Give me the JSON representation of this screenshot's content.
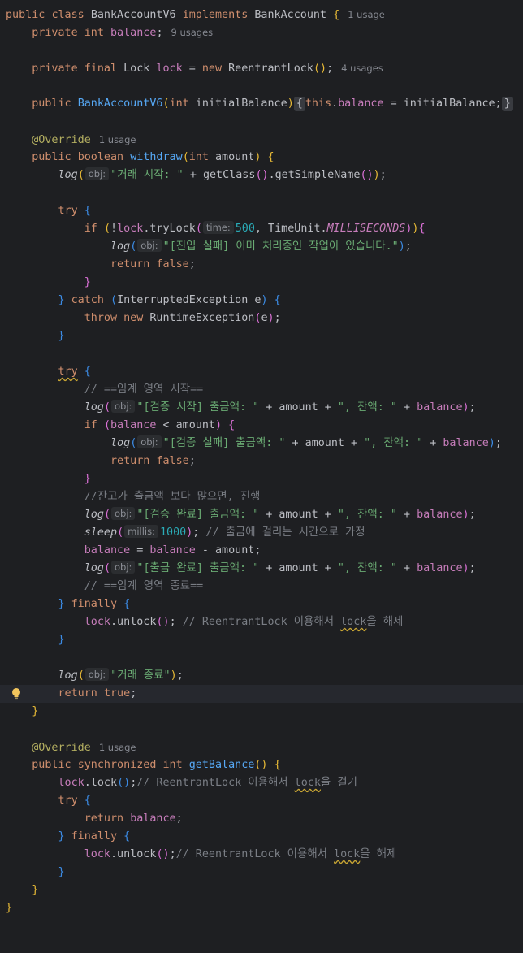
{
  "bank_class": {
    "kw_public": "public",
    "kw_class": "class",
    "name": "BankAccountV6",
    "kw_implements": "implements",
    "iface": "BankAccount",
    "brace": "{",
    "usage": "1 usage"
  },
  "balance_field": {
    "kw_private": "private",
    "kw_int": "int",
    "name": "balance",
    "semi": ";",
    "usage": "9 usages"
  },
  "lock_field": {
    "kw_private": "private",
    "kw_final": "final",
    "type": "Lock",
    "name": "lock",
    "eq": "=",
    "kw_new": "new",
    "ctor": "ReentrantLock",
    "parens": "()",
    "semi": ";",
    "usage": "4 usages"
  },
  "constructor": {
    "kw_public": "public",
    "name": "BankAccountV6",
    "open": "(",
    "kw_int": "int",
    "param": "initialBalance",
    "close": ")",
    "fold_open": "{",
    "kw_this": "this",
    "dot": ".",
    "field": "balance",
    "assign": "=",
    "value": "initialBalance;",
    "fold_close": "}"
  },
  "withdraw": {
    "annotation": "@Override",
    "usage": "1 usage",
    "kw_public": "public",
    "kw_boolean": "boolean",
    "name": "withdraw",
    "open": "(",
    "kw_int": "int",
    "param": "amount",
    "close": ")",
    "brace": "{"
  },
  "log_start": {
    "fn": "log",
    "open": "(",
    "hint": "obj:",
    "str": "\"거래 시작: \"",
    "plus": "+",
    "call1": "getClass",
    "p1": "()",
    "call2": ".getSimpleName",
    "p2": "()",
    "close": ")",
    "semi": ";"
  },
  "try1": {
    "kw_try": "try",
    "brace": "{"
  },
  "if_trylock": {
    "kw_if": "if",
    "open": "(",
    "not": "!",
    "field": "lock",
    "call": ".tryLock",
    "p_open": "(",
    "hint": "time:",
    "num": "500",
    "comma": ",",
    "cls": "TimeUnit.",
    "const": "MILLISECONDS",
    "p_close": ")",
    "close": ")",
    "brace": "{"
  },
  "log_enter_fail": {
    "fn": "log",
    "open": "(",
    "hint": "obj:",
    "str": "\"[진입 실패] 이미 처리중인 작업이 있습니다.\"",
    "close": ")",
    "semi": ";"
  },
  "return_false_1": {
    "kw_return": "return",
    "kw_false": "false",
    "semi": ";"
  },
  "close_if1": {
    "brace": "}"
  },
  "catch_line": {
    "close_brace": "}",
    "kw_catch": "catch",
    "open": "(",
    "type": "InterruptedException",
    "var": "e",
    "close": ")",
    "brace": "{"
  },
  "throw_line": {
    "kw_throw": "throw",
    "kw_new": "new",
    "type": "RuntimeException",
    "open": "(",
    "arg": "e",
    "close": ")",
    "semi": ";"
  },
  "close_catch": {
    "brace": "}"
  },
  "try2": {
    "kw_try": "try",
    "brace": "{"
  },
  "comment_start": "// ==임계 영역 시작==",
  "log_check_start": {
    "fn": "log",
    "open": "(",
    "hint": "obj:",
    "str1": "\"[검증 시작] 출금액: \"",
    "plus1": "+",
    "amount": "amount",
    "plus2": "+",
    "str2": "\", 잔액: \"",
    "plus3": "+",
    "balance": "balance",
    "close": ")",
    "semi": ";"
  },
  "if_balance": {
    "kw_if": "if",
    "open": "(",
    "field": "balance",
    "lt": "<",
    "var": "amount",
    "close": ")",
    "brace": "{"
  },
  "log_check_fail": {
    "fn": "log",
    "open": "(",
    "hint": "obj:",
    "str1": "\"[검증 실패] 출금액: \"",
    "plus1": "+",
    "amount": "amount",
    "plus2": "+",
    "str2": "\", 잔액: \"",
    "plus3": "+",
    "balance": "balance",
    "close": ")",
    "semi": ";"
  },
  "return_false_2": {
    "kw_return": "return",
    "kw_false": "false",
    "semi": ";"
  },
  "close_if2": {
    "brace": "}"
  },
  "comment_proceed": "//잔고가 출금액 보다 많으면, 진행",
  "log_check_done": {
    "fn": "log",
    "open": "(",
    "hint": "obj:",
    "str1": "\"[검증 완료] 출금액: \"",
    "plus1": "+",
    "amount": "amount",
    "plus2": "+",
    "str2": "\", 잔액: \"",
    "plus3": "+",
    "balance": "balance",
    "close": ")",
    "semi": ";"
  },
  "sleep_line": {
    "fn": "sleep",
    "open": "(",
    "hint": "millis:",
    "num": "1000",
    "close": ")",
    "semi": ";",
    "comment": "// 출금에 걸리는 시간으로 가정"
  },
  "assign_line": {
    "field1": "balance",
    "eq": "=",
    "field2": "balance",
    "minus": "-",
    "var": "amount",
    "semi": ";"
  },
  "log_withdraw_done": {
    "fn": "log",
    "open": "(",
    "hint": "obj:",
    "str1": "\"[출금 완료] 출금액: \"",
    "plus1": "+",
    "amount": "amount",
    "plus2": "+",
    "str2": "\", 잔액: \"",
    "plus3": "+",
    "balance": "balance",
    "close": ")",
    "semi": ";"
  },
  "comment_end": "// ==임계 영역 종료==",
  "finally1": {
    "close_brace": "}",
    "kw_finally": "finally",
    "brace": "{"
  },
  "unlock1": {
    "field": "lock",
    "call": ".unlock",
    "parens": "()",
    "semi": ";",
    "comment_pre": "// ReentrantLock 이용해서 ",
    "comment_lock": "lock",
    "comment_post": "을 해제"
  },
  "close_finally1": {
    "brace": "}"
  },
  "log_end": {
    "fn": "log",
    "open": "(",
    "hint": "obj:",
    "str": "\"거래 종료\"",
    "close": ")",
    "semi": ";"
  },
  "return_true": {
    "kw_return": "return",
    "kw_true": "true",
    "semi": ";"
  },
  "close_withdraw": {
    "brace": "}"
  },
  "get_balance": {
    "annotation": "@Override",
    "usage": "1 usage",
    "kw_public": "public",
    "kw_sync": "synchronized",
    "kw_int": "int",
    "name": "getBalance",
    "parens": "()",
    "brace": "{"
  },
  "lock_line": {
    "field": "lock",
    "call": ".lock",
    "parens": "()",
    "semi": ";",
    "comment_pre": "// ReentrantLock 이용해서 ",
    "comment_lock": "lock",
    "comment_post": "을 걸기"
  },
  "try3": {
    "kw_try": "try",
    "brace": "{"
  },
  "return_balance": {
    "kw_return": "return",
    "field": "balance",
    "semi": ";"
  },
  "finally2": {
    "close_brace": "}",
    "kw_finally": "finally",
    "brace": "{"
  },
  "unlock2": {
    "field": "lock",
    "call": ".unlock",
    "parens": "()",
    "semi": ";",
    "comment_pre": "// ReentrantLock 이용해서 ",
    "comment_lock": "lock",
    "comment_post": "을 해제"
  },
  "close_finally2": {
    "brace": "}"
  },
  "close_getbalance": {
    "brace": "}"
  },
  "close_class": {
    "brace": "}"
  },
  "colors": {
    "background": "#1e1f22",
    "current_line": "#26282e",
    "keyword": "#cf8e6d",
    "string": "#6aab73",
    "field": "#c77dbb",
    "method": "#56a8f5",
    "number": "#2aacb8",
    "comment": "#7a7e85",
    "annotation": "#b3ae60"
  },
  "icons": {
    "gutter": "lightbulb-icon"
  }
}
